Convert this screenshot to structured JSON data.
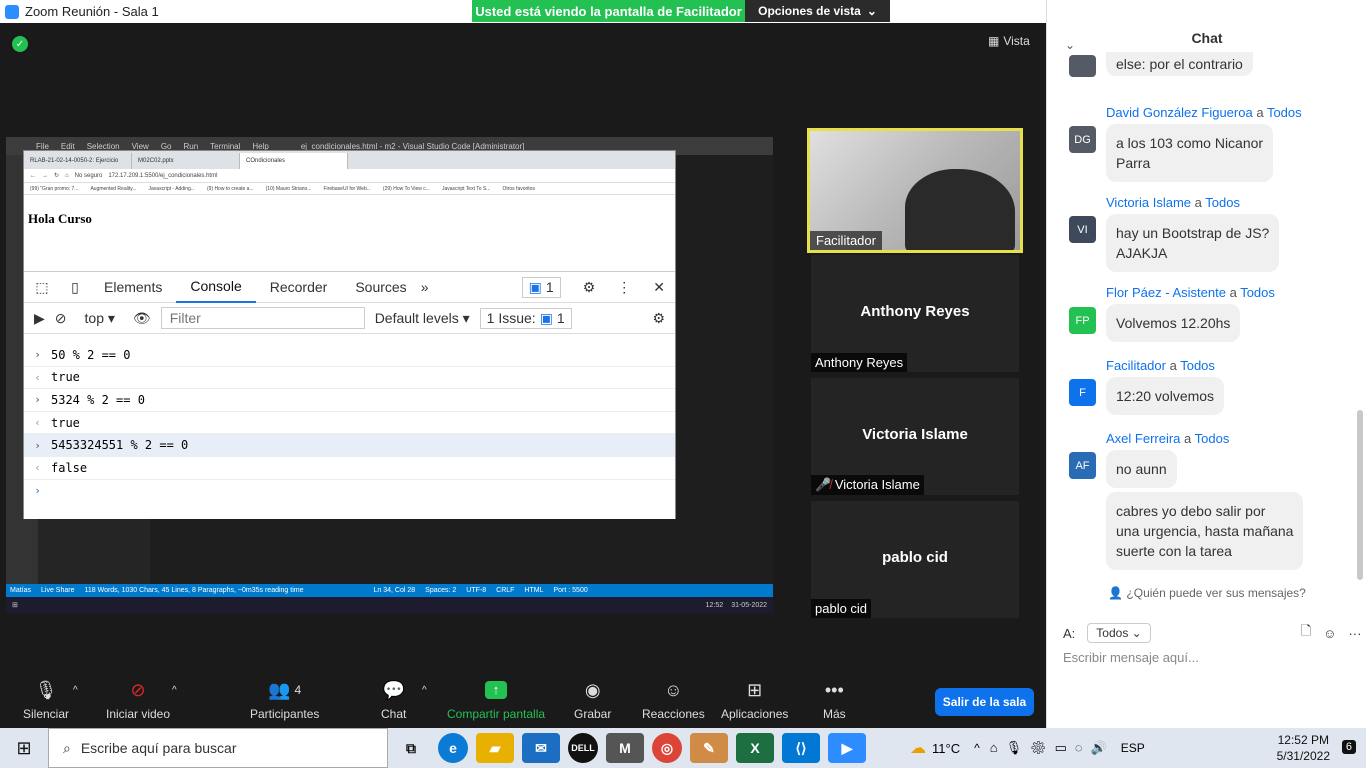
{
  "window": {
    "title": "Zoom Reunión - Sala 1",
    "viewing_banner": "Usted está viendo la pantalla de Facilitador",
    "view_options": "Opciones de vista",
    "vista": "Vista"
  },
  "vscode": {
    "menu": [
      "File",
      "Edit",
      "Selection",
      "View",
      "Go",
      "Run",
      "Terminal",
      "Help"
    ],
    "title": "ej_condicionales.html - m2 - Visual Studio Code [Administrator]",
    "status": [
      "Matías",
      "Live Share",
      "118 Words, 1030 Chars, 45 Lines, 8 Paragraphs, ~0m35s reading time",
      "Ln 34, Col 28",
      "Spaces: 2",
      "UTF-8",
      "CRLF",
      "HTML",
      "Port : 5500"
    ],
    "clock": "12:52",
    "date": "31-05-2022"
  },
  "browser": {
    "tabs": [
      "RLAB-21-02-14-0050-2: Ejercicio",
      "M02C02.pptx",
      "COndicionales"
    ],
    "address": "172.17.209.1:5500/ej_condicionales.html",
    "insecure": "No seguro",
    "bookmarks": [
      "(99) \"Gran promo: 7...",
      "Augmented Reality...",
      "Javascript - Adding...",
      "(9) How to create a...",
      "(10) Mauro Striano...",
      "FirebaseUI for Web...",
      "(29) How To View c...",
      "Javascript Text To S...",
      "Otros favoritos"
    ],
    "page_heading": "Hola Curso"
  },
  "devtools": {
    "tabs": [
      "Elements",
      "Console",
      "Recorder",
      "Sources"
    ],
    "active_tab": "Console",
    "messages_count": "1",
    "context": "top",
    "filter_placeholder": "Filter",
    "levels": "Default levels",
    "issues": "1 Issue:",
    "issues_count": "1",
    "console_lines": [
      {
        "type": "input",
        "text": "50 % 2 == 0"
      },
      {
        "type": "result",
        "text": "true"
      },
      {
        "type": "input",
        "text": "5324 % 2 == 0"
      },
      {
        "type": "result",
        "text": "true"
      },
      {
        "type": "input",
        "text": "5453324551 % 2 == 0"
      },
      {
        "type": "result",
        "text": "false"
      }
    ]
  },
  "participants": [
    {
      "name": "Facilitador",
      "video": true
    },
    {
      "name": "Anthony Reyes",
      "label": "Anthony Reyes",
      "muted": false
    },
    {
      "name": "Victoria Islame",
      "label": "Victoria Islame",
      "muted": true
    },
    {
      "name": "pablo cid",
      "label": "pablo cid",
      "muted": false
    }
  ],
  "toolbar": {
    "mute": "Silenciar",
    "video": "Iniciar video",
    "participants": "Participantes",
    "participants_count": "4",
    "chat": "Chat",
    "share": "Compartir pantalla",
    "record": "Grabar",
    "reactions": "Reacciones",
    "apps": "Aplicaciones",
    "more": "Más",
    "leave": "Salir de la sala"
  },
  "chat": {
    "header": "Chat",
    "partial_message": "else:  por el contrario",
    "messages": [
      {
        "sender": "David González Figueroa",
        "to": "Todos",
        "initials": "DG",
        "color": "#555b66",
        "lines": [
          "a los 103 como Nicanor",
          "Parra"
        ]
      },
      {
        "sender": "Victoria Islame",
        "to": "Todos",
        "initials": "VI",
        "color": "#3e4a5c",
        "lines": [
          "hay un Bootstrap de JS?",
          "AJAKJA"
        ]
      },
      {
        "sender": "Flor Páez - Asistente",
        "to": "Todos",
        "initials": "FP",
        "color": "#23c052",
        "lines": [
          "Volvemos 12.20hs"
        ]
      },
      {
        "sender": "Facilitador",
        "to": "Todos",
        "initials": "F",
        "color": "#0e72ed",
        "lines": [
          "12:20 volvemos"
        ]
      },
      {
        "sender": "Axel Ferreira",
        "to": "Todos",
        "initials": "AF",
        "color": "#2a6bb5",
        "lines": [
          "no aunn"
        ]
      },
      {
        "sender": "",
        "to": "",
        "initials": "",
        "color": "",
        "lines": [
          "cabres yo debo salir por",
          "una urgencia, hasta mañana",
          "suerte con la tarea"
        ]
      }
    ],
    "to_word": "a",
    "who_can_see": "¿Quién puede ver sus mensajes?",
    "to_label": "A:",
    "to_value": "Todos",
    "input_placeholder": "Escribir mensaje aquí..."
  },
  "taskbar": {
    "search_placeholder": "Escribe aquí para buscar",
    "temperature": "11°C",
    "language": "ESP",
    "time": "12:52 PM",
    "date": "5/31/2022",
    "notifications": "6"
  }
}
